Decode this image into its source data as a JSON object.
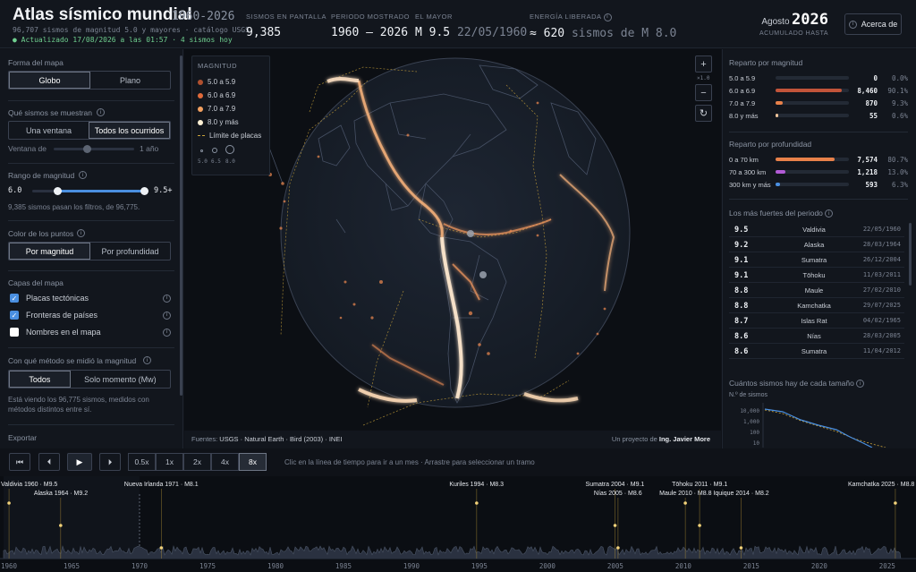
{
  "header": {
    "title": "Atlas sísmico mundial",
    "years": "1960-2026",
    "subtitle": "96,707 sismos de magnitud 5.0 y mayores · catálogo USGS",
    "updated": "● Actualizado 17/08/2026 a las 01:57 · 4 sismos hoy",
    "stats": {
      "on_screen_label": "SISMOS EN PANTALLA",
      "on_screen_value": "9,385",
      "period_label": "PERIODO MOSTRADO",
      "period_value": "1960 – 2026",
      "largest_label": "EL MAYOR",
      "largest_value": "M 9.5",
      "largest_date": "22/05/1960",
      "energy_label": "ENERGÍA LIBERADA",
      "energy_value": "≈ 620",
      "energy_unit": "sismos de M 8.0"
    },
    "month": "Agosto",
    "year": "2026",
    "accum": "ACUMULADO HASTA",
    "about": "Acerca de"
  },
  "left": {
    "map_shape_title": "Forma del mapa",
    "map_shape_options": [
      "Globo",
      "Plano"
    ],
    "which_title": "Qué sismos se muestran",
    "which_options": [
      "Una ventana",
      "Todos los ocurridos"
    ],
    "window_label": "Ventana de",
    "window_value": "1 año",
    "range_title": "Rango de magnitud",
    "range_min": "6.0",
    "range_max": "9.5+",
    "range_min_fraction": 0.22,
    "range_max_fraction": 1.0,
    "range_note": "9,385 sismos pasan los filtros, de 96,775.",
    "color_title": "Color de los puntos",
    "color_options": [
      "Por magnitud",
      "Por profundidad"
    ],
    "layers_title": "Capas del mapa",
    "layers": [
      {
        "label": "Placas tectónicas",
        "checked": true
      },
      {
        "label": "Fronteras de países",
        "checked": true
      },
      {
        "label": "Nombres en el mapa",
        "checked": false
      }
    ],
    "method_title": "Con qué método se midió la magnitud",
    "method_options": [
      "Todos",
      "Solo momento (Mw)"
    ],
    "method_note": "Está viendo los 96,775 sismos, medidos con métodos distintos entre sí.",
    "export_title": "Exportar"
  },
  "map": {
    "legend_title": "MAGNITUD",
    "legend": [
      {
        "label": "5.0 a 5.9",
        "color": "#b0502f"
      },
      {
        "label": "6.0 a 6.9",
        "color": "#e06a3a"
      },
      {
        "label": "7.0 a 7.9",
        "color": "#f2a060"
      },
      {
        "label": "8.0 y más",
        "color": "#fff1d6"
      }
    ],
    "plates_label": "Límite de placas",
    "size_labels": [
      "5.0",
      "6.5",
      "8.0"
    ],
    "zoom_level": "×1.0",
    "sources_prefix": "Fuentes:",
    "sources": "USGS · Natural Earth · Bird (2003) · INEI",
    "credit_prefix": "Un proyecto de",
    "credit_name": "Ing. Javier More"
  },
  "right": {
    "mag_title": "Reparto por magnitud",
    "mag_rows": [
      {
        "label": "5.0 a 5.9",
        "count": "0",
        "pct": "0.0%",
        "frac": 0.0,
        "color": "#b0502f"
      },
      {
        "label": "6.0 a 6.9",
        "count": "8,460",
        "pct": "90.1%",
        "frac": 0.901,
        "color": "#c2543a"
      },
      {
        "label": "7.0 a 7.9",
        "count": "870",
        "pct": "9.3%",
        "frac": 0.093,
        "color": "#e8814a"
      },
      {
        "label": "8.0 y más",
        "count": "55",
        "pct": "0.6%",
        "frac": 0.006,
        "color": "#f2c49a"
      }
    ],
    "depth_title": "Reparto por profundidad",
    "depth_rows": [
      {
        "label": "0 a 70 km",
        "count": "7,574",
        "pct": "80.7%",
        "frac": 0.807,
        "color": "#e8814a"
      },
      {
        "label": "70 a 300 km",
        "count": "1,218",
        "pct": "13.0%",
        "frac": 0.13,
        "color": "#b25bd6"
      },
      {
        "label": "300 km y más",
        "count": "593",
        "pct": "6.3%",
        "frac": 0.063,
        "color": "#4a8fe0"
      }
    ],
    "strongest_title": "Los más fuertes del periodo",
    "strongest": [
      {
        "mag": "9.5",
        "place": "Valdivia",
        "date": "22/05/1960"
      },
      {
        "mag": "9.2",
        "place": "Alaska",
        "date": "28/03/1964"
      },
      {
        "mag": "9.1",
        "place": "Sumatra",
        "date": "26/12/2004"
      },
      {
        "mag": "9.1",
        "place": "Tōhoku",
        "date": "11/03/2011"
      },
      {
        "mag": "8.8",
        "place": "Maule",
        "date": "27/02/2010"
      },
      {
        "mag": "8.8",
        "place": "Kamchatka",
        "date": "29/07/2025"
      },
      {
        "mag": "8.7",
        "place": "Islas Rat",
        "date": "04/02/1965"
      },
      {
        "mag": "8.6",
        "place": "Nías",
        "date": "28/03/2005"
      },
      {
        "mag": "8.6",
        "place": "Sumatra",
        "date": "11/04/2012"
      }
    ],
    "gr_title": "Cuántos sismos hay de cada tamaño",
    "gr_ylabel": "N.º de sismos",
    "gr_ticks": [
      "10,000",
      "1,000",
      "100",
      "10"
    ]
  },
  "controls": {
    "speeds": [
      "0.5x",
      "1x",
      "2x",
      "4x",
      "8x"
    ],
    "active_speed": "8x",
    "hint": "Clic en la línea de tiempo para ir a un mes · Arrastre para seleccionar un tramo"
  },
  "timeline": {
    "events": [
      {
        "label": "Valdivia 1960 · M9.5",
        "year": 1960.4
      },
      {
        "label": "Alaska 1964 · M9.2",
        "year": 1964.2
      },
      {
        "label": "Nueva Irlanda 1971 · M8.1",
        "year": 1971.6
      },
      {
        "label": "Kuriles 1994 · M8.3",
        "year": 1994.8
      },
      {
        "label": "Sumatra 2004 · M9.1",
        "year": 2004.98
      },
      {
        "label": "Nías 2005 · M8.6",
        "year": 2005.2
      },
      {
        "label": "Maule 2010 · M8.8",
        "year": 2010.15
      },
      {
        "label": "Tōhoku 2011 · M9.1",
        "year": 2011.2
      },
      {
        "label": "Iquique 2014 · M8.2",
        "year": 2014.25
      },
      {
        "label": "Kamchatka 2025 · M8.8",
        "year": 2025.6
      }
    ],
    "years": [
      "1960",
      "1965",
      "1970",
      "1975",
      "1980",
      "1985",
      "1990",
      "1995",
      "2000",
      "2005",
      "2010",
      "2015",
      "2020",
      "2025"
    ]
  },
  "colors": {
    "accent": "#4a8fe0",
    "quake_hot": "#fff1d6",
    "plate": "#c9a23a"
  }
}
